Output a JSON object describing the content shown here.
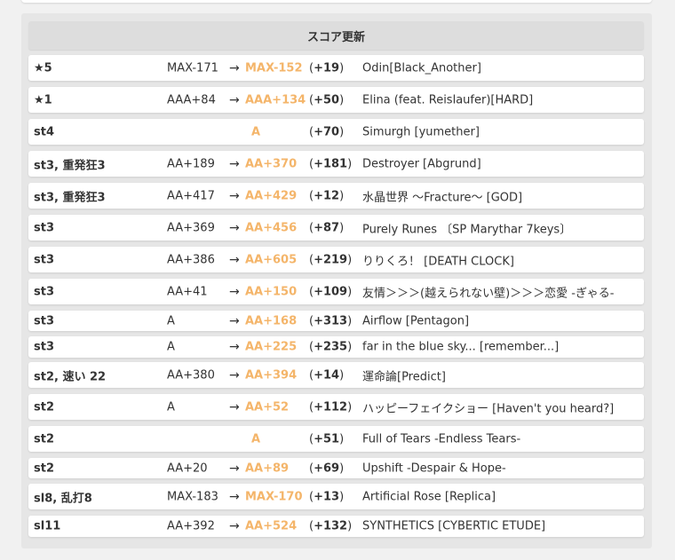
{
  "section": {
    "title": "スコア更新"
  },
  "colors": {
    "accent": "#f4b56a",
    "panel_bg": "#e6e6e6",
    "row_bg": "#ffffff",
    "header_bg": "#dddddd"
  },
  "arrow": "→",
  "rows": [
    {
      "level": "★5",
      "old": "MAX-171",
      "new": "MAX-152",
      "diff": "+19",
      "title": "Odin[Black_Another]"
    },
    {
      "level": "★1",
      "old": "AAA+84",
      "new": "AAA+134",
      "diff": "+50",
      "title": "Elina (feat. Reislaufer)[HARD]"
    },
    {
      "level": "st4",
      "old": "",
      "new": "A",
      "diff": "+70",
      "title": "Simurgh [yumether]"
    },
    {
      "level": "st3, 重発狂3",
      "old": "AA+189",
      "new": "AA+370",
      "diff": "+181",
      "title": "Destroyer [Abgrund]"
    },
    {
      "level": "st3, 重発狂3",
      "old": "AA+417",
      "new": "AA+429",
      "diff": "+12",
      "title": "水晶世界 〜Fracture〜 [GOD]"
    },
    {
      "level": "st3",
      "old": "AA+369",
      "new": "AA+456",
      "diff": "+87",
      "title": "Purely Runes 〔SP Marythar 7keys〕"
    },
    {
      "level": "st3",
      "old": "AA+386",
      "new": "AA+605",
      "diff": "+219",
      "title": "りりくろ！ [DEATH CLOCK]"
    },
    {
      "level": "st3",
      "old": "AA+41",
      "new": "AA+150",
      "diff": "+109",
      "title": "友情＞＞＞(越えられない壁)＞＞＞恋愛 -ぎゃる-"
    },
    {
      "level": "st3",
      "old": "A",
      "new": "AA+168",
      "diff": "+313",
      "title": "Airflow [Pentagon]"
    },
    {
      "level": "st3",
      "old": "A",
      "new": "AA+225",
      "diff": "+235",
      "title": "far in the blue sky... [remember...]"
    },
    {
      "level": "st2, 速い 22",
      "old": "AA+380",
      "new": "AA+394",
      "diff": "+14",
      "title": "運命論[Predict]"
    },
    {
      "level": "st2",
      "old": "A",
      "new": "AA+52",
      "diff": "+112",
      "title": "ハッピーフェイクショー [Haven't you heard?]"
    },
    {
      "level": "st2",
      "old": "",
      "new": "A",
      "diff": "+51",
      "title": "Full of Tears -Endless Tears-"
    },
    {
      "level": "st2",
      "old": "AA+20",
      "new": "AA+89",
      "diff": "+69",
      "title": "Upshift -Despair & Hope-"
    },
    {
      "level": "sl8, 乱打8",
      "old": "MAX-183",
      "new": "MAX-170",
      "diff": "+13",
      "title": "Artificial Rose [Replica]"
    },
    {
      "level": "sl11",
      "old": "AA+392",
      "new": "AA+524",
      "diff": "+132",
      "title": "SYNTHETICS [CYBERTIC ETUDE]"
    }
  ]
}
